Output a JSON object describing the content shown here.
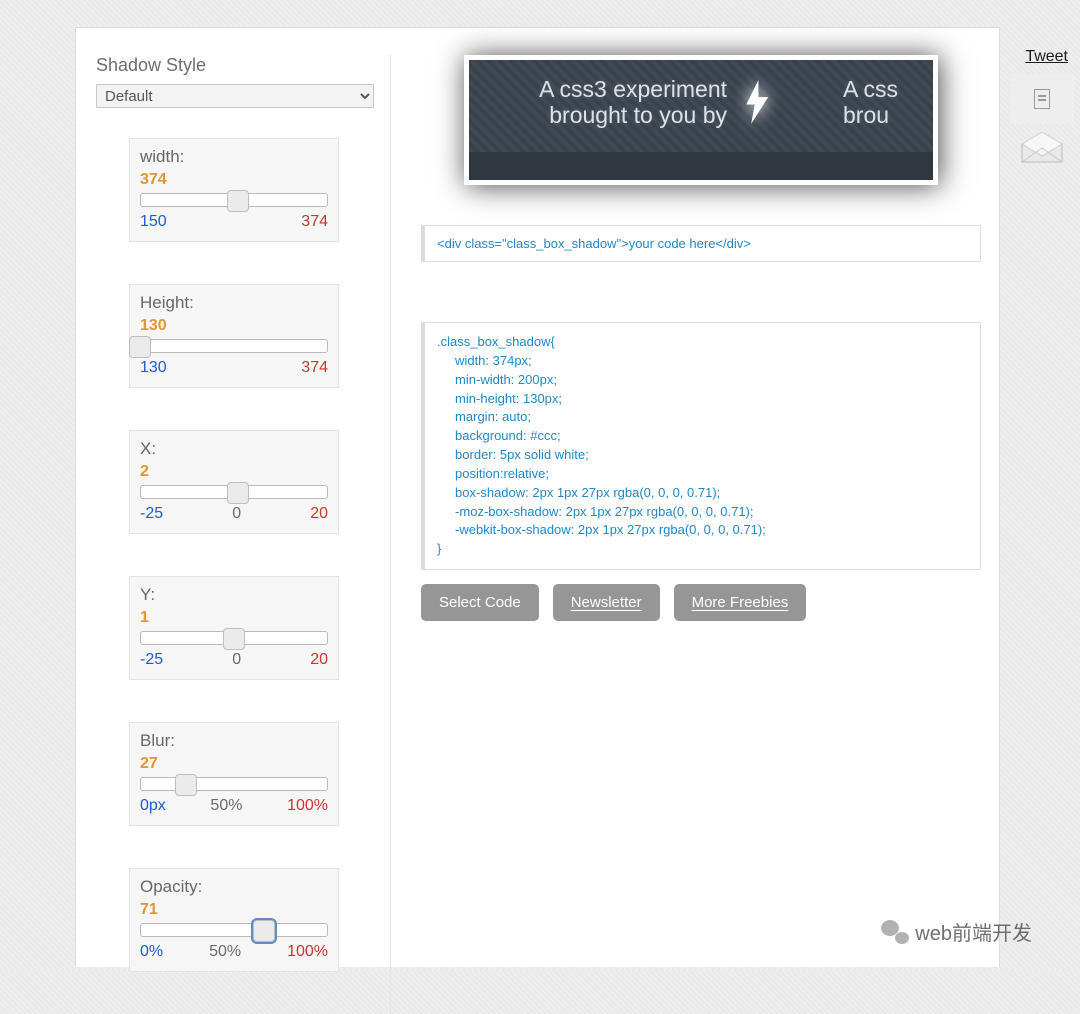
{
  "title": "Shadow Style",
  "style_select": {
    "selected": "Default"
  },
  "sliders": [
    {
      "label": "width:",
      "value": "374",
      "min": "150",
      "mid": "",
      "max": "374",
      "thumb_pct": 52,
      "thumb_overflow_left": false
    },
    {
      "label": "Height:",
      "value": "130",
      "min": "130",
      "mid": "",
      "max": "374",
      "thumb_pct": 0,
      "thumb_overflow_left": true
    },
    {
      "label": "X:",
      "value": "2",
      "min": "-25",
      "mid": "0",
      "max": "20",
      "thumb_pct": 52,
      "thumb_overflow_left": false
    },
    {
      "label": "Y:",
      "value": "1",
      "min": "-25",
      "mid": "0",
      "max": "20",
      "thumb_pct": 50,
      "thumb_overflow_left": false
    },
    {
      "label": "Blur:",
      "value": "27",
      "min": "0px",
      "mid": "50%",
      "max": "100%",
      "thumb_pct": 24,
      "thumb_overflow_left": false
    },
    {
      "label": "Opacity:",
      "value": "71",
      "min": "0%",
      "mid": "50%",
      "max": "100%",
      "thumb_pct": 66,
      "thumb_overflow_left": false,
      "thumb_focus": true
    }
  ],
  "ad": {
    "line1": "A css3 experiment",
    "line2": "brought to you by",
    "line1_r": "A css",
    "line2_r": "brou"
  },
  "code_html": "<div class=\"class_box_shadow\">your code here</div>",
  "code_css": ".class_box_shadow{\n     width: 374px;\n     min-width: 200px;\n     min-height: 130px;\n     margin: auto;\n     background: #ccc;\n     border: 5px solid white;\n     position:relative;\n     box-shadow: 2px 1px 27px rgba(0, 0, 0, 0.71);\n     -moz-box-shadow: 2px 1px 27px rgba(0, 0, 0, 0.71);\n     -webkit-box-shadow: 2px 1px 27px rgba(0, 0, 0, 0.71);\n}",
  "buttons": {
    "select": "Select Code",
    "newsletter": "Newsletter",
    "freebies": "More Freebies"
  },
  "share": {
    "tweet": "Tweet"
  },
  "watermark": "web前端开发"
}
